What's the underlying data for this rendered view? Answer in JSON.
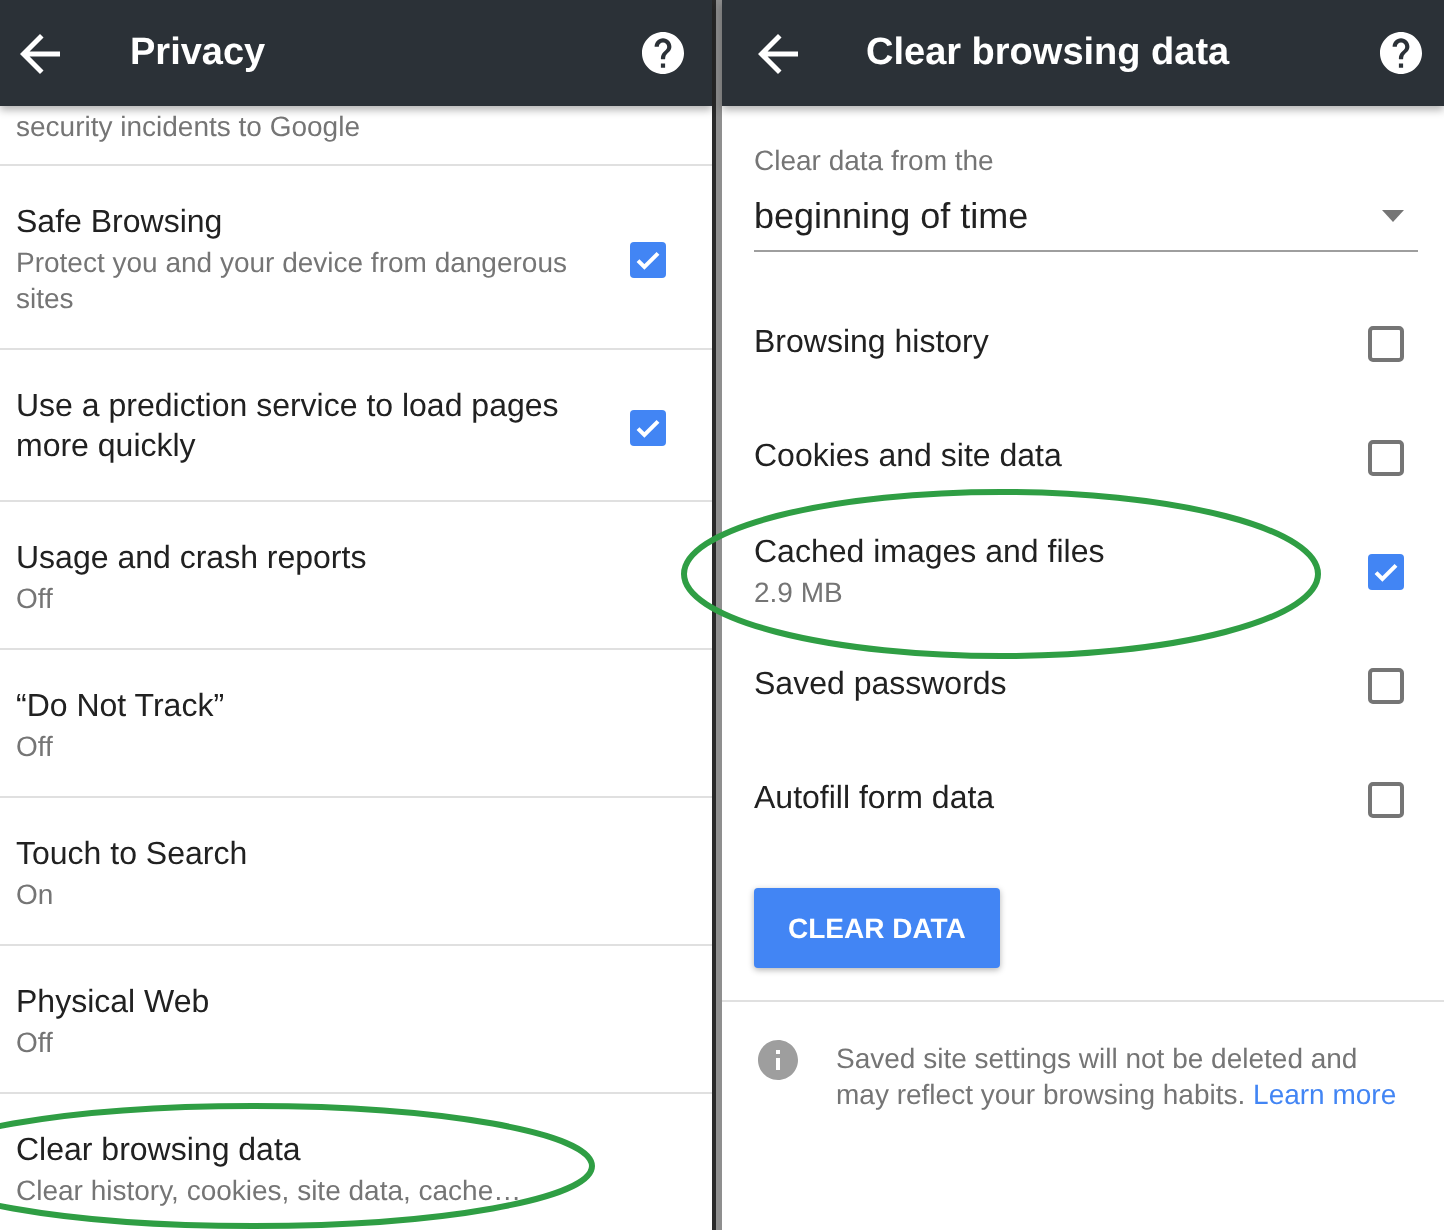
{
  "privacy_screen": {
    "title": "Privacy",
    "scrolled_text": "security incidents to Google",
    "items": [
      {
        "kind": "checkbox",
        "title": "Safe Browsing",
        "summary": "Protect you and your device from dangerous sites",
        "checked": true,
        "circled": false
      },
      {
        "kind": "checkbox",
        "title": "Use a prediction service to load pages more quickly",
        "checked": true,
        "circled": false
      },
      {
        "kind": "link",
        "title": "Usage and crash reports",
        "summary": "Off",
        "circled": false
      },
      {
        "kind": "link",
        "title": "“Do Not Track”",
        "summary": "Off",
        "circled": false
      },
      {
        "kind": "link",
        "title": "Touch to Search",
        "summary": "On",
        "circled": false
      },
      {
        "kind": "link",
        "title": "Physical Web",
        "summary": "Off",
        "circled": false
      },
      {
        "kind": "link",
        "title": "Clear browsing data",
        "summary": "Clear history, cookies, site data, cache…",
        "circled": true
      }
    ]
  },
  "clear_screen": {
    "title": "Clear browsing data",
    "time_range": {
      "label": "Clear data from the",
      "value": "beginning of time"
    },
    "options": [
      {
        "label": "Browsing history",
        "checked": false,
        "circled": false
      },
      {
        "label": "Cookies and site data",
        "checked": false,
        "circled": false
      },
      {
        "label": "Cached images and files",
        "detail": "2.9 MB",
        "checked": true,
        "circled": true
      },
      {
        "label": "Saved passwords",
        "checked": false,
        "circled": false
      },
      {
        "label": "Autofill form data",
        "checked": false,
        "circled": false
      }
    ],
    "button": "CLEAR DATA",
    "notice": {
      "text": "Saved site settings will not be deleted and may reflect your browsing habits.",
      "link": "Learn more"
    }
  }
}
